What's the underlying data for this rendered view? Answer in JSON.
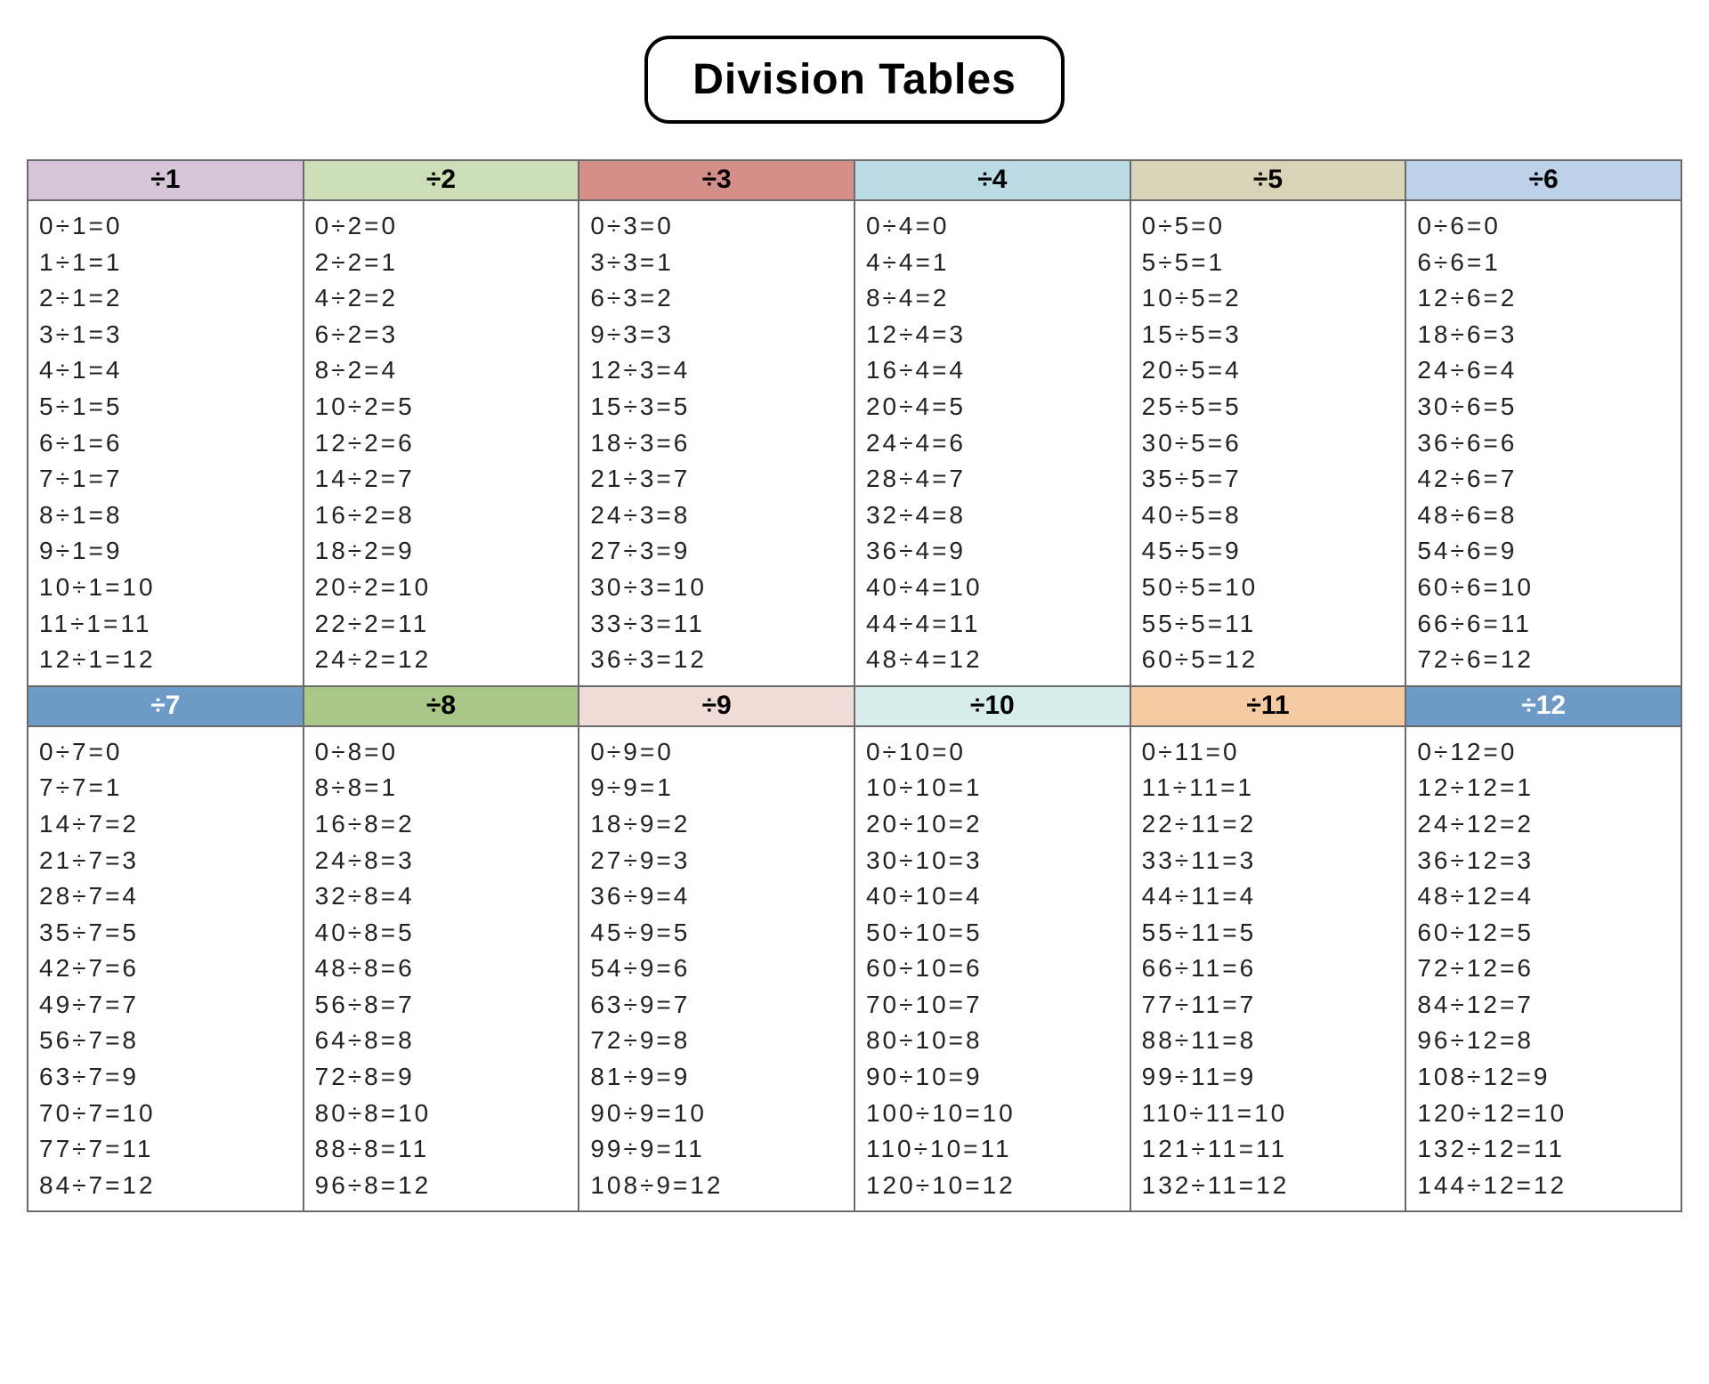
{
  "title": "Division Tables",
  "divisors": [
    1,
    2,
    3,
    4,
    5,
    6,
    7,
    8,
    9,
    10,
    11,
    12
  ],
  "results": [
    0,
    1,
    2,
    3,
    4,
    5,
    6,
    7,
    8,
    9,
    10,
    11,
    12
  ],
  "headerColors": {
    "1": "#d7c6da",
    "2": "#cddfb6",
    "3": "#d58f89",
    "4": "#bbdce4",
    "5": "#d9d3b8",
    "6": "#bdd1e9",
    "7": "#6d9bc5",
    "8": "#aac78a",
    "9": "#f1dbd6",
    "10": "#d6eced",
    "11": "#f4caa2",
    "12": "#6d9bc5"
  },
  "headerTextColor": {
    "7": "#ffffff",
    "12": "#ffffff"
  },
  "chart_data": {
    "type": "table",
    "title": "Division Tables",
    "description": "Division facts for divisors 1 through 12, each showing dividend ÷ divisor = quotient for quotients 0–12.",
    "tables": [
      {
        "divisor": 1,
        "rows": [
          {
            "dividend": 0,
            "quotient": 0
          },
          {
            "dividend": 1,
            "quotient": 1
          },
          {
            "dividend": 2,
            "quotient": 2
          },
          {
            "dividend": 3,
            "quotient": 3
          },
          {
            "dividend": 4,
            "quotient": 4
          },
          {
            "dividend": 5,
            "quotient": 5
          },
          {
            "dividend": 6,
            "quotient": 6
          },
          {
            "dividend": 7,
            "quotient": 7
          },
          {
            "dividend": 8,
            "quotient": 8
          },
          {
            "dividend": 9,
            "quotient": 9
          },
          {
            "dividend": 10,
            "quotient": 10
          },
          {
            "dividend": 11,
            "quotient": 11
          },
          {
            "dividend": 12,
            "quotient": 12
          }
        ]
      },
      {
        "divisor": 2,
        "rows": [
          {
            "dividend": 0,
            "quotient": 0
          },
          {
            "dividend": 2,
            "quotient": 1
          },
          {
            "dividend": 4,
            "quotient": 2
          },
          {
            "dividend": 6,
            "quotient": 3
          },
          {
            "dividend": 8,
            "quotient": 4
          },
          {
            "dividend": 10,
            "quotient": 5
          },
          {
            "dividend": 12,
            "quotient": 6
          },
          {
            "dividend": 14,
            "quotient": 7
          },
          {
            "dividend": 16,
            "quotient": 8
          },
          {
            "dividend": 18,
            "quotient": 9
          },
          {
            "dividend": 20,
            "quotient": 10
          },
          {
            "dividend": 22,
            "quotient": 11
          },
          {
            "dividend": 24,
            "quotient": 12
          }
        ]
      },
      {
        "divisor": 3,
        "rows": [
          {
            "dividend": 0,
            "quotient": 0
          },
          {
            "dividend": 3,
            "quotient": 1
          },
          {
            "dividend": 6,
            "quotient": 2
          },
          {
            "dividend": 9,
            "quotient": 3
          },
          {
            "dividend": 12,
            "quotient": 4
          },
          {
            "dividend": 15,
            "quotient": 5
          },
          {
            "dividend": 18,
            "quotient": 6
          },
          {
            "dividend": 21,
            "quotient": 7
          },
          {
            "dividend": 24,
            "quotient": 8
          },
          {
            "dividend": 27,
            "quotient": 9
          },
          {
            "dividend": 30,
            "quotient": 10
          },
          {
            "dividend": 33,
            "quotient": 11
          },
          {
            "dividend": 36,
            "quotient": 12
          }
        ]
      },
      {
        "divisor": 4,
        "rows": [
          {
            "dividend": 0,
            "quotient": 0
          },
          {
            "dividend": 4,
            "quotient": 1
          },
          {
            "dividend": 8,
            "quotient": 2
          },
          {
            "dividend": 12,
            "quotient": 3
          },
          {
            "dividend": 16,
            "quotient": 4
          },
          {
            "dividend": 20,
            "quotient": 5
          },
          {
            "dividend": 24,
            "quotient": 6
          },
          {
            "dividend": 28,
            "quotient": 7
          },
          {
            "dividend": 32,
            "quotient": 8
          },
          {
            "dividend": 36,
            "quotient": 9
          },
          {
            "dividend": 40,
            "quotient": 10
          },
          {
            "dividend": 44,
            "quotient": 11
          },
          {
            "dividend": 48,
            "quotient": 12
          }
        ]
      },
      {
        "divisor": 5,
        "rows": [
          {
            "dividend": 0,
            "quotient": 0
          },
          {
            "dividend": 5,
            "quotient": 1
          },
          {
            "dividend": 10,
            "quotient": 2
          },
          {
            "dividend": 15,
            "quotient": 3
          },
          {
            "dividend": 20,
            "quotient": 4
          },
          {
            "dividend": 25,
            "quotient": 5
          },
          {
            "dividend": 30,
            "quotient": 6
          },
          {
            "dividend": 35,
            "quotient": 7
          },
          {
            "dividend": 40,
            "quotient": 8
          },
          {
            "dividend": 45,
            "quotient": 9
          },
          {
            "dividend": 50,
            "quotient": 10
          },
          {
            "dividend": 55,
            "quotient": 11
          },
          {
            "dividend": 60,
            "quotient": 12
          }
        ]
      },
      {
        "divisor": 6,
        "rows": [
          {
            "dividend": 0,
            "quotient": 0
          },
          {
            "dividend": 6,
            "quotient": 1
          },
          {
            "dividend": 12,
            "quotient": 2
          },
          {
            "dividend": 18,
            "quotient": 3
          },
          {
            "dividend": 24,
            "quotient": 4
          },
          {
            "dividend": 30,
            "quotient": 5
          },
          {
            "dividend": 36,
            "quotient": 6
          },
          {
            "dividend": 42,
            "quotient": 7
          },
          {
            "dividend": 48,
            "quotient": 8
          },
          {
            "dividend": 54,
            "quotient": 9
          },
          {
            "dividend": 60,
            "quotient": 10
          },
          {
            "dividend": 66,
            "quotient": 11
          },
          {
            "dividend": 72,
            "quotient": 12
          }
        ]
      },
      {
        "divisor": 7,
        "rows": [
          {
            "dividend": 0,
            "quotient": 0
          },
          {
            "dividend": 7,
            "quotient": 1
          },
          {
            "dividend": 14,
            "quotient": 2
          },
          {
            "dividend": 21,
            "quotient": 3
          },
          {
            "dividend": 28,
            "quotient": 4
          },
          {
            "dividend": 35,
            "quotient": 5
          },
          {
            "dividend": 42,
            "quotient": 6
          },
          {
            "dividend": 49,
            "quotient": 7
          },
          {
            "dividend": 56,
            "quotient": 8
          },
          {
            "dividend": 63,
            "quotient": 9
          },
          {
            "dividend": 70,
            "quotient": 10
          },
          {
            "dividend": 77,
            "quotient": 11
          },
          {
            "dividend": 84,
            "quotient": 12
          }
        ]
      },
      {
        "divisor": 8,
        "rows": [
          {
            "dividend": 0,
            "quotient": 0
          },
          {
            "dividend": 8,
            "quotient": 1
          },
          {
            "dividend": 16,
            "quotient": 2
          },
          {
            "dividend": 24,
            "quotient": 3
          },
          {
            "dividend": 32,
            "quotient": 4
          },
          {
            "dividend": 40,
            "quotient": 5
          },
          {
            "dividend": 48,
            "quotient": 6
          },
          {
            "dividend": 56,
            "quotient": 7
          },
          {
            "dividend": 64,
            "quotient": 8
          },
          {
            "dividend": 72,
            "quotient": 9
          },
          {
            "dividend": 80,
            "quotient": 10
          },
          {
            "dividend": 88,
            "quotient": 11
          },
          {
            "dividend": 96,
            "quotient": 12
          }
        ]
      },
      {
        "divisor": 9,
        "rows": [
          {
            "dividend": 0,
            "quotient": 0
          },
          {
            "dividend": 9,
            "quotient": 1
          },
          {
            "dividend": 18,
            "quotient": 2
          },
          {
            "dividend": 27,
            "quotient": 3
          },
          {
            "dividend": 36,
            "quotient": 4
          },
          {
            "dividend": 45,
            "quotient": 5
          },
          {
            "dividend": 54,
            "quotient": 6
          },
          {
            "dividend": 63,
            "quotient": 7
          },
          {
            "dividend": 72,
            "quotient": 8
          },
          {
            "dividend": 81,
            "quotient": 9
          },
          {
            "dividend": 90,
            "quotient": 10
          },
          {
            "dividend": 99,
            "quotient": 11
          },
          {
            "dividend": 108,
            "quotient": 12
          }
        ]
      },
      {
        "divisor": 10,
        "rows": [
          {
            "dividend": 0,
            "quotient": 0
          },
          {
            "dividend": 10,
            "quotient": 1
          },
          {
            "dividend": 20,
            "quotient": 2
          },
          {
            "dividend": 30,
            "quotient": 3
          },
          {
            "dividend": 40,
            "quotient": 4
          },
          {
            "dividend": 50,
            "quotient": 5
          },
          {
            "dividend": 60,
            "quotient": 6
          },
          {
            "dividend": 70,
            "quotient": 7
          },
          {
            "dividend": 80,
            "quotient": 8
          },
          {
            "dividend": 90,
            "quotient": 9
          },
          {
            "dividend": 100,
            "quotient": 10
          },
          {
            "dividend": 110,
            "quotient": 11
          },
          {
            "dividend": 120,
            "quotient": 12
          }
        ]
      },
      {
        "divisor": 11,
        "rows": [
          {
            "dividend": 0,
            "quotient": 0
          },
          {
            "dividend": 11,
            "quotient": 1
          },
          {
            "dividend": 22,
            "quotient": 2
          },
          {
            "dividend": 33,
            "quotient": 3
          },
          {
            "dividend": 44,
            "quotient": 4
          },
          {
            "dividend": 55,
            "quotient": 5
          },
          {
            "dividend": 66,
            "quotient": 6
          },
          {
            "dividend": 77,
            "quotient": 7
          },
          {
            "dividend": 88,
            "quotient": 8
          },
          {
            "dividend": 99,
            "quotient": 9
          },
          {
            "dividend": 110,
            "quotient": 10
          },
          {
            "dividend": 121,
            "quotient": 11
          },
          {
            "dividend": 132,
            "quotient": 12
          }
        ]
      },
      {
        "divisor": 12,
        "rows": [
          {
            "dividend": 0,
            "quotient": 0
          },
          {
            "dividend": 12,
            "quotient": 1
          },
          {
            "dividend": 24,
            "quotient": 2
          },
          {
            "dividend": 36,
            "quotient": 3
          },
          {
            "dividend": 48,
            "quotient": 4
          },
          {
            "dividend": 60,
            "quotient": 5
          },
          {
            "dividend": 72,
            "quotient": 6
          },
          {
            "dividend": 84,
            "quotient": 7
          },
          {
            "dividend": 96,
            "quotient": 8
          },
          {
            "dividend": 108,
            "quotient": 9
          },
          {
            "dividend": 120,
            "quotient": 10
          },
          {
            "dividend": 132,
            "quotient": 11
          },
          {
            "dividend": 144,
            "quotient": 12
          }
        ]
      }
    ]
  }
}
